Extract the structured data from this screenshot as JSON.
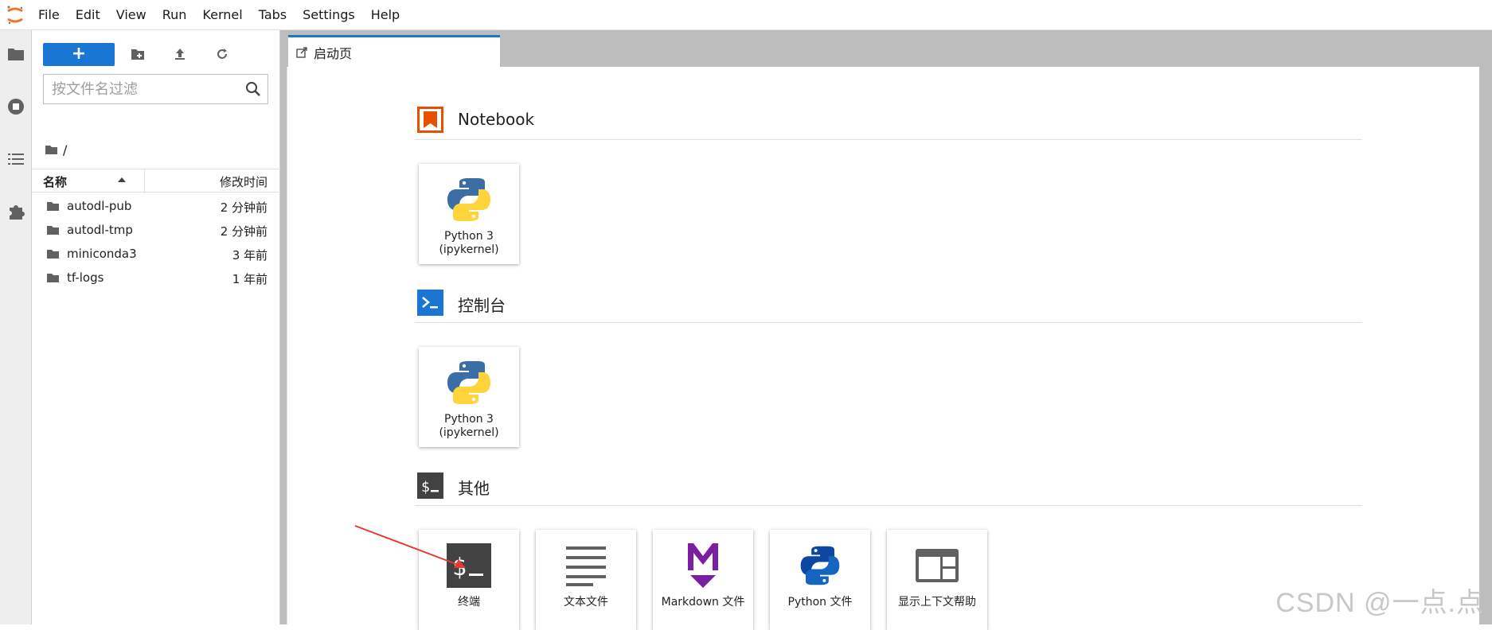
{
  "menubar": {
    "items": [
      "File",
      "Edit",
      "View",
      "Run",
      "Kernel",
      "Tabs",
      "Settings",
      "Help"
    ]
  },
  "filebrowser": {
    "new_launcher_label": "+",
    "search_placeholder": "按文件名过滤",
    "breadcrumb": "/",
    "columns": {
      "name": "名称",
      "modified": "修改时间"
    },
    "files": [
      {
        "name": "autodl-pub",
        "modified": "2 分钟前"
      },
      {
        "name": "autodl-tmp",
        "modified": "2 分钟前"
      },
      {
        "name": "miniconda3",
        "modified": "3 年前"
      },
      {
        "name": "tf-logs",
        "modified": "1 年前"
      }
    ]
  },
  "tabs": [
    {
      "label": "启动页"
    }
  ],
  "launcher": {
    "sections": [
      {
        "title": "Notebook",
        "cards": [
          {
            "line1": "Python 3",
            "line2": "(ipykernel)"
          }
        ]
      },
      {
        "title": "控制台",
        "cards": [
          {
            "line1": "Python 3",
            "line2": "(ipykernel)"
          }
        ]
      },
      {
        "title": "其他",
        "cards": [
          {
            "label": "终端"
          },
          {
            "label": "文本文件"
          },
          {
            "label": "Markdown 文件"
          },
          {
            "label": "Python 文件"
          },
          {
            "label": "显示上下文帮助"
          }
        ]
      }
    ]
  },
  "watermark": "CSDN @一点.点",
  "colors": {
    "accent": "#1976d2",
    "notebook_icon": "#e65100",
    "console_icon": "#1976d2",
    "other_icon": "#424242",
    "markdown_icon": "#7b1fa2",
    "python_blue": "#3a6ea5",
    "python_yellow": "#ffd43b",
    "annotation_arrow": "#e53935"
  }
}
